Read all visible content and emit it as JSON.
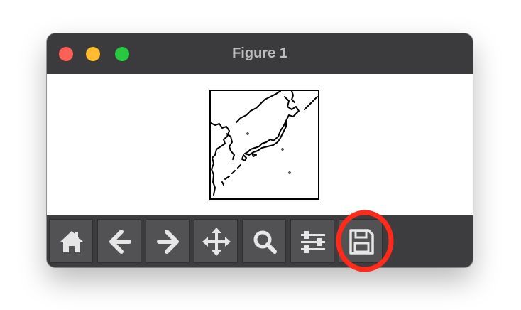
{
  "window": {
    "title": "Figure 1"
  },
  "titlebar": {
    "buttons": [
      "close",
      "minimize",
      "zoom"
    ]
  },
  "toolbar": {
    "tools": [
      {
        "name": "home",
        "icon": "home-icon"
      },
      {
        "name": "back",
        "icon": "arrow-left-icon"
      },
      {
        "name": "forward",
        "icon": "arrow-right-icon"
      },
      {
        "name": "pan",
        "icon": "move-icon"
      },
      {
        "name": "zoom",
        "icon": "magnifier-icon"
      },
      {
        "name": "configure-subplots",
        "icon": "sliders-icon"
      },
      {
        "name": "save",
        "icon": "floppy-disk-icon"
      }
    ]
  },
  "annotation": {
    "highlighted_tool": "save",
    "color": "#ff2a1a"
  },
  "colors": {
    "titlebar": "#3b3b3d",
    "toolbar": "#3d3d3f",
    "tool_button": "#525254",
    "icon": "#e6e6e6",
    "close": "#fe5f57",
    "minimize": "#febc2e",
    "zoom": "#28c840"
  }
}
